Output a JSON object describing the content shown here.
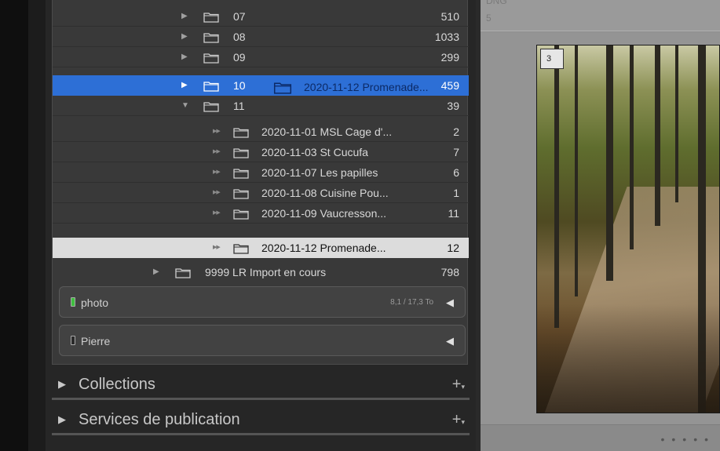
{
  "folders": [
    {
      "name": "07",
      "count": "510"
    },
    {
      "name": "08",
      "count": "1033"
    },
    {
      "name": "09",
      "count": "299"
    },
    {
      "name": "10",
      "count": "459",
      "drag_label": "2020-11-12 Promenade..."
    },
    {
      "name": "11",
      "count": "39"
    }
  ],
  "subfolders": [
    {
      "name": "2020-11-01 MSL Cage d'...",
      "count": "2"
    },
    {
      "name": "2020-11-03 St Cucufa",
      "count": "7"
    },
    {
      "name": "2020-11-07 Les papilles",
      "count": "6"
    },
    {
      "name": "2020-11-08 Cuisine Pou...",
      "count": "1"
    },
    {
      "name": "2020-11-09 Vaucresson...",
      "count": "11"
    },
    {
      "name": "2020-11-12 Promenade...",
      "count": "12"
    }
  ],
  "import_folder": {
    "name": "9999 LR Import en cours",
    "count": "798"
  },
  "volumes": [
    {
      "name": "photo",
      "size": "8,1 / 17,3 To",
      "led_color": "#3fbf3f"
    },
    {
      "name": "Pierre",
      "size": "",
      "led_color": "#2a2a2a"
    }
  ],
  "sections": {
    "collections": "Collections",
    "publish": "Services de publication"
  },
  "gallery": {
    "meta_line1": "DNG",
    "meta_line2": "5",
    "cell_index": "3"
  },
  "colors": {
    "selection_blue": "#2d6fd6",
    "highlight_gray": "#dcdcdc"
  }
}
